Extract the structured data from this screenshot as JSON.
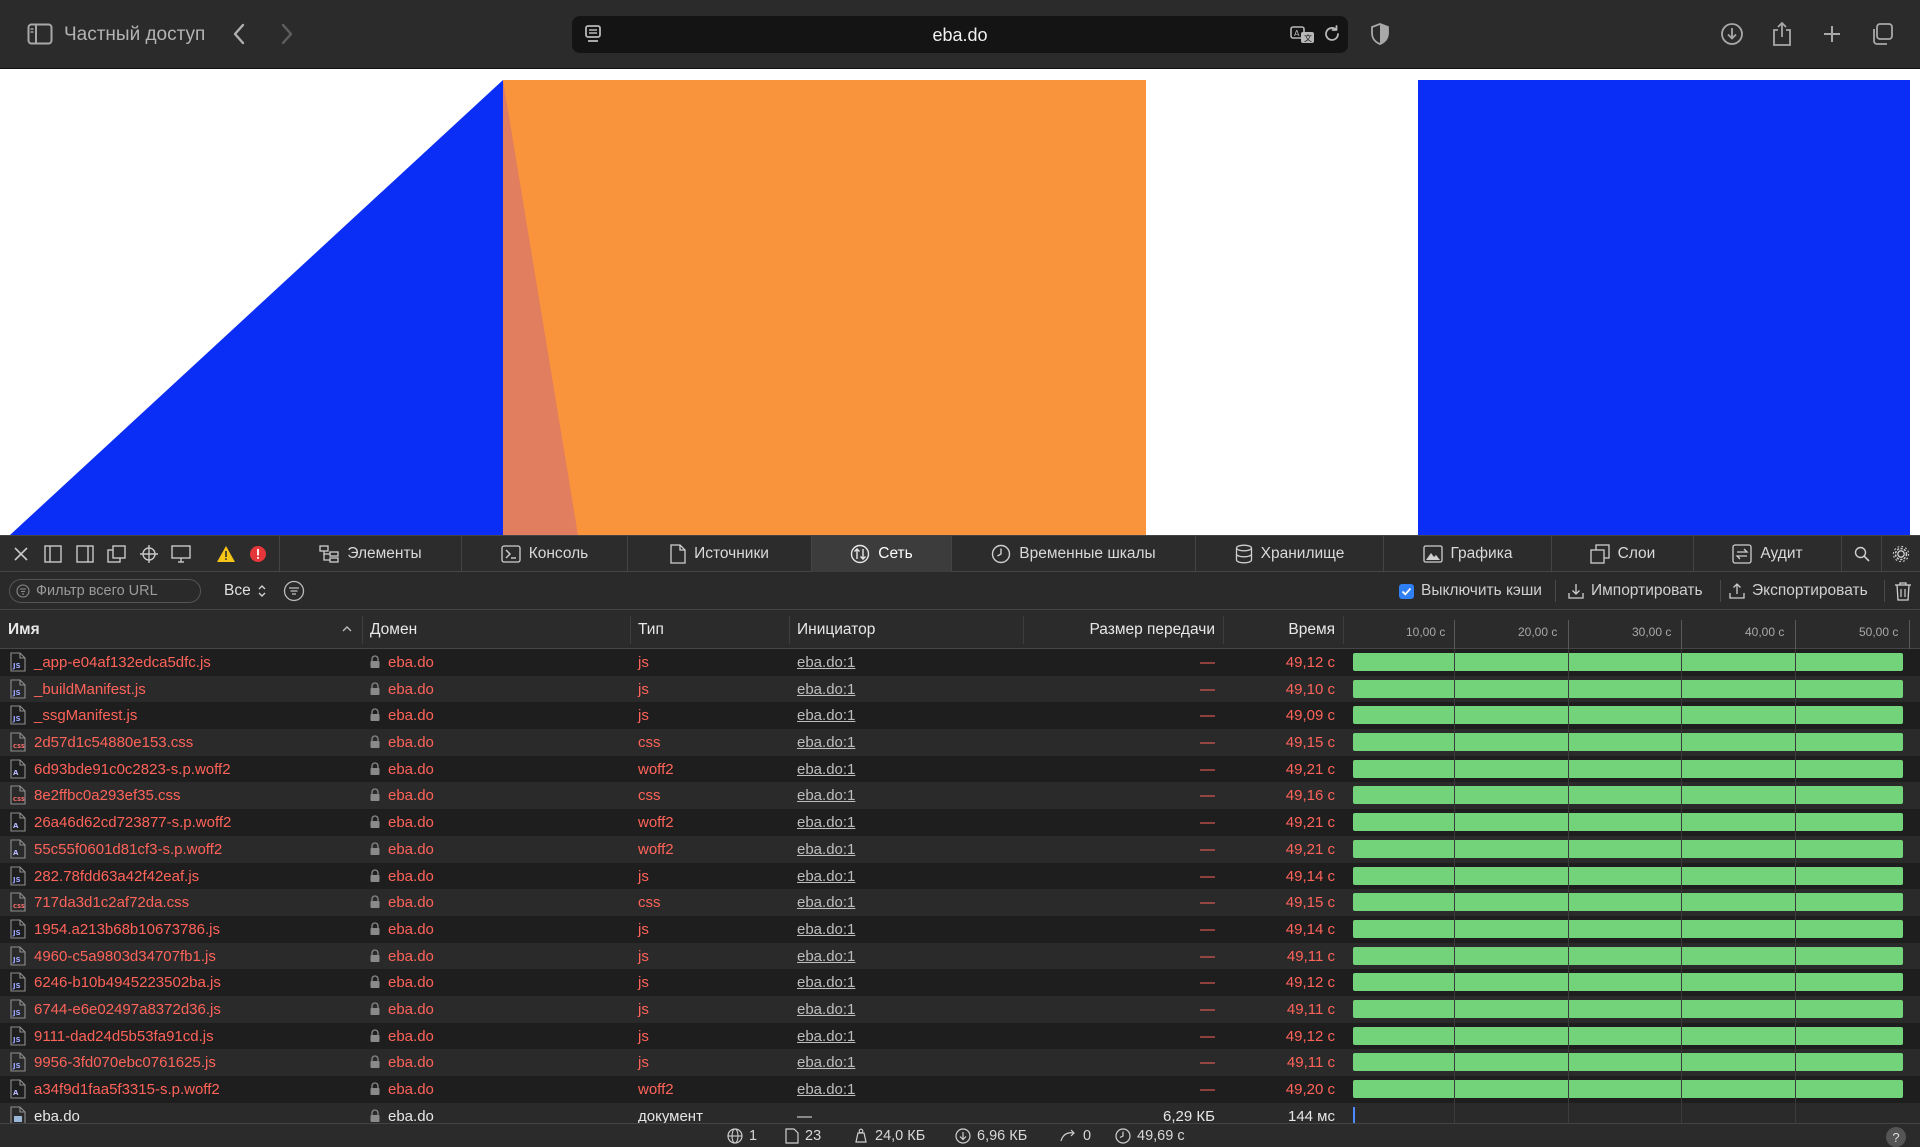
{
  "browser": {
    "private_label": "Частный доступ",
    "url": "eba.do"
  },
  "devtools": {
    "tabs": [
      {
        "label": "Элементы",
        "icon": "elements-icon"
      },
      {
        "label": "Консоль",
        "icon": "console-icon"
      },
      {
        "label": "Источники",
        "icon": "sources-icon"
      },
      {
        "label": "Сеть",
        "icon": "network-icon",
        "active": true
      },
      {
        "label": "Временные шкалы",
        "icon": "timelines-icon"
      },
      {
        "label": "Хранилище",
        "icon": "storage-icon"
      },
      {
        "label": "Графика",
        "icon": "graphics-icon"
      },
      {
        "label": "Слои",
        "icon": "layers-icon"
      },
      {
        "label": "Аудит",
        "icon": "audit-icon"
      }
    ],
    "filter": {
      "placeholder": "Фильтр всего URL",
      "type_select": "Все",
      "disable_cache_label": "Выключить кэши",
      "disable_cache_checked": true,
      "import_label": "Импортировать",
      "export_label": "Экспортировать"
    },
    "columns": {
      "name": "Имя",
      "domain": "Домен",
      "type": "Тип",
      "initiator": "Инициатор",
      "size": "Размер передачи",
      "time": "Время"
    },
    "timeline_ticks": [
      "10,00 с",
      "20,00 с",
      "30,00 с",
      "40,00 с",
      "50,00 с"
    ],
    "requests": [
      {
        "name": "_app-e04af132edca5dfc.js",
        "domain": "eba.do",
        "type": "js",
        "initiator": "eba.do:1",
        "size": "—",
        "time": "49,12 с",
        "kind": "js",
        "duration_fraction": 0.982
      },
      {
        "name": "_buildManifest.js",
        "domain": "eba.do",
        "type": "js",
        "initiator": "eba.do:1",
        "size": "—",
        "time": "49,10 с",
        "kind": "js",
        "duration_fraction": 0.982
      },
      {
        "name": "_ssgManifest.js",
        "domain": "eba.do",
        "type": "js",
        "initiator": "eba.do:1",
        "size": "—",
        "time": "49,09 с",
        "kind": "js",
        "duration_fraction": 0.982
      },
      {
        "name": "2d57d1c54880e153.css",
        "domain": "eba.do",
        "type": "css",
        "initiator": "eba.do:1",
        "size": "—",
        "time": "49,15 с",
        "kind": "css",
        "duration_fraction": 0.982
      },
      {
        "name": "6d93bde91c0c2823-s.p.woff2",
        "domain": "eba.do",
        "type": "woff2",
        "initiator": "eba.do:1",
        "size": "—",
        "time": "49,21 с",
        "kind": "font",
        "duration_fraction": 0.982
      },
      {
        "name": "8e2ffbc0a293ef35.css",
        "domain": "eba.do",
        "type": "css",
        "initiator": "eba.do:1",
        "size": "—",
        "time": "49,16 с",
        "kind": "css",
        "duration_fraction": 0.982
      },
      {
        "name": "26a46d62cd723877-s.p.woff2",
        "domain": "eba.do",
        "type": "woff2",
        "initiator": "eba.do:1",
        "size": "—",
        "time": "49,21 с",
        "kind": "font",
        "duration_fraction": 0.982
      },
      {
        "name": "55c55f0601d81cf3-s.p.woff2",
        "domain": "eba.do",
        "type": "woff2",
        "initiator": "eba.do:1",
        "size": "—",
        "time": "49,21 с",
        "kind": "font",
        "duration_fraction": 0.982
      },
      {
        "name": "282.78fdd63a42f42eaf.js",
        "domain": "eba.do",
        "type": "js",
        "initiator": "eba.do:1",
        "size": "—",
        "time": "49,14 с",
        "kind": "js",
        "duration_fraction": 0.982
      },
      {
        "name": "717da3d1c2af72da.css",
        "domain": "eba.do",
        "type": "css",
        "initiator": "eba.do:1",
        "size": "—",
        "time": "49,15 с",
        "kind": "css",
        "duration_fraction": 0.982
      },
      {
        "name": "1954.a213b68b10673786.js",
        "domain": "eba.do",
        "type": "js",
        "initiator": "eba.do:1",
        "size": "—",
        "time": "49,14 с",
        "kind": "js",
        "duration_fraction": 0.982
      },
      {
        "name": "4960-c5a9803d34707fb1.js",
        "domain": "eba.do",
        "type": "js",
        "initiator": "eba.do:1",
        "size": "—",
        "time": "49,11 с",
        "kind": "js",
        "duration_fraction": 0.982
      },
      {
        "name": "6246-b10b4945223502ba.js",
        "domain": "eba.do",
        "type": "js",
        "initiator": "eba.do:1",
        "size": "—",
        "time": "49,12 с",
        "kind": "js",
        "duration_fraction": 0.982
      },
      {
        "name": "6744-e6e02497a8372d36.js",
        "domain": "eba.do",
        "type": "js",
        "initiator": "eba.do:1",
        "size": "—",
        "time": "49,11 с",
        "kind": "js",
        "duration_fraction": 0.982
      },
      {
        "name": "9111-dad24d5b53fa91cd.js",
        "domain": "eba.do",
        "type": "js",
        "initiator": "eba.do:1",
        "size": "—",
        "time": "49,12 с",
        "kind": "js",
        "duration_fraction": 0.982
      },
      {
        "name": "9956-3fd070ebc0761625.js",
        "domain": "eba.do",
        "type": "js",
        "initiator": "eba.do:1",
        "size": "—",
        "time": "49,11 с",
        "kind": "js",
        "duration_fraction": 0.982
      },
      {
        "name": "a34f9d1faa5f3315-s.p.woff2",
        "domain": "eba.do",
        "type": "woff2",
        "initiator": "eba.do:1",
        "size": "—",
        "time": "49,20 с",
        "kind": "font",
        "duration_fraction": 0.982
      },
      {
        "name": "eba.do",
        "domain": "eba.do",
        "type": "документ",
        "initiator": "—",
        "size": "6,29 КБ",
        "time": "144 мс",
        "kind": "doc",
        "duration_fraction": 0.0
      }
    ],
    "status": {
      "resources": "1",
      "requests": "23",
      "transferred": "24,0 КБ",
      "size": "6,96 КБ",
      "redirects": "0",
      "total_time": "49,69 с",
      "help": "?"
    }
  },
  "colors": {
    "page_blue": "#0a2ef5",
    "page_orange": "#fa943c",
    "page_orange_shade": "#e07e5f",
    "error_red": "#ff6359",
    "bar_green": "#73d37a"
  }
}
